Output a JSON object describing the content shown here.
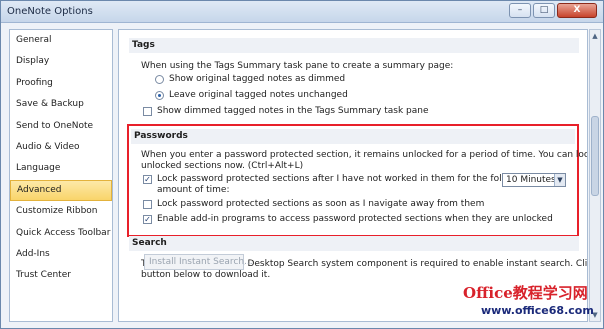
{
  "window": {
    "title": "OneNote Options",
    "minimize": "–",
    "maximize": "□",
    "close": "X"
  },
  "sidebar": {
    "items": [
      {
        "label": "General"
      },
      {
        "label": "Display"
      },
      {
        "label": "Proofing"
      },
      {
        "label": "Save & Backup"
      },
      {
        "label": "Send to OneNote"
      },
      {
        "label": "Audio & Video"
      },
      {
        "label": "Language"
      },
      {
        "label": "Advanced",
        "selected": true
      },
      {
        "label": "Customize Ribbon"
      },
      {
        "label": "Quick Access Toolbar"
      },
      {
        "label": "Add-Ins"
      },
      {
        "label": "Trust Center"
      }
    ]
  },
  "tags": {
    "header": "Tags",
    "intro": "When using the Tags Summary task pane to create a summary page:",
    "radio1": "Show original tagged notes as dimmed",
    "radio2": "Leave original tagged notes unchanged",
    "check1": "Show dimmed tagged notes in the Tags Summary task pane",
    "radio_selected": 2,
    "check1_checked": false
  },
  "passwords": {
    "header": "Passwords",
    "intro_line1": "When you enter a password protected section, it remains unlocked for a period of time. You can lock any",
    "intro_line2": "unlocked sections now. (Ctrl+Alt+L)",
    "check1_line1": "Lock password protected sections after I have not worked in them for the following",
    "check1_line2": "amount of time:",
    "check1_checked": true,
    "timeout_value": "10 Minutes",
    "check2": "Lock password protected sections as soon as I navigate away from them",
    "check2_checked": false,
    "check3": "Enable add-in programs to access password protected sections when they are unlocked",
    "check3_checked": true
  },
  "search": {
    "header": "Search",
    "line1": "The Microsoft Windows Desktop Search system component is required to enable instant search. Click the",
    "line2": "button below to download it.",
    "button": "Install Instant Search..."
  },
  "watermark": {
    "brand": "Office教程学习网",
    "url": "www.office68.com"
  },
  "colors": {
    "highlight": "#e8202a",
    "selected_item": "#f9d46a"
  }
}
